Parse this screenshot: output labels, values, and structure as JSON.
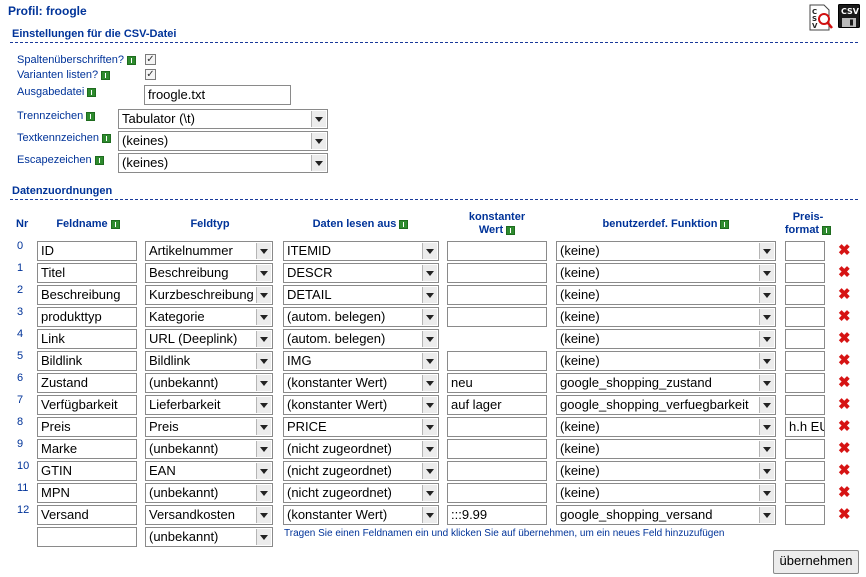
{
  "profile": {
    "title": "Profil: froogle"
  },
  "toolbar": {
    "csv_label": "CSV"
  },
  "csv_settings": {
    "heading": "Einstellungen für die CSV-Datei",
    "column_headers": {
      "label": "Spaltenüberschriften?",
      "checked": true
    },
    "list_variants": {
      "label": "Varianten listen?",
      "checked": true
    },
    "output_file": {
      "label": "Ausgabedatei",
      "value": "froogle.txt"
    },
    "separator": {
      "label": "Trennzeichen",
      "value": "Tabulator (\\t)"
    },
    "text_qualifier": {
      "label": "Textkennzeichen",
      "value": "(keines)"
    },
    "escape_char": {
      "label": "Escapezeichen",
      "value": "(keines)"
    }
  },
  "mapping": {
    "heading": "Datenzuordnungen",
    "columns": {
      "nr": "Nr",
      "field_name": "Feldname",
      "field_type": "Feldtyp",
      "read_from": "Daten lesen aus",
      "constant": [
        "konstanter",
        "Wert"
      ],
      "function": "benutzerdef. Funktion",
      "price_format": [
        "Preis-",
        "format"
      ]
    },
    "rows": [
      {
        "nr": "0",
        "name": "ID",
        "type": "Artikelnummer",
        "source": "ITEMID",
        "constant": "",
        "constant_field": true,
        "func": "(keine)",
        "price": ""
      },
      {
        "nr": "1",
        "name": "Titel",
        "type": "Beschreibung",
        "source": "DESCR",
        "constant": "",
        "constant_field": true,
        "func": "(keine)",
        "price": ""
      },
      {
        "nr": "2",
        "name": "Beschreibung",
        "type": "Kurzbeschreibung",
        "source": "DETAIL",
        "constant": "",
        "constant_field": true,
        "func": "(keine)",
        "price": ""
      },
      {
        "nr": "3",
        "name": "produkttyp",
        "type": "Kategorie",
        "source": "(autom. belegen)",
        "constant": "",
        "constant_field": true,
        "func": "(keine)",
        "price": ""
      },
      {
        "nr": "4",
        "name": "Link",
        "type": "URL (Deeplink)",
        "source": "(autom. belegen)",
        "constant": "",
        "constant_field": false,
        "func": "(keine)",
        "price": ""
      },
      {
        "nr": "5",
        "name": "Bildlink",
        "type": "Bildlink",
        "source": "IMG",
        "constant": "",
        "constant_field": true,
        "func": "(keine)",
        "price": ""
      },
      {
        "nr": "6",
        "name": "Zustand",
        "type": "(unbekannt)",
        "source": "(konstanter Wert)",
        "constant": "neu",
        "constant_field": true,
        "func": "google_shopping_zustand",
        "price": ""
      },
      {
        "nr": "7",
        "name": "Verfügbarkeit",
        "type": "Lieferbarkeit",
        "source": "(konstanter Wert)",
        "constant": "auf lager",
        "constant_field": true,
        "func": "google_shopping_verfuegbarkeit",
        "price": ""
      },
      {
        "nr": "8",
        "name": "Preis",
        "type": "Preis",
        "source": "PRICE",
        "constant": "",
        "constant_field": true,
        "func": "(keine)",
        "price": "h.h EUR"
      },
      {
        "nr": "9",
        "name": "Marke",
        "type": "(unbekannt)",
        "source": "(nicht zugeordnet)",
        "constant": "",
        "constant_field": true,
        "func": "(keine)",
        "price": ""
      },
      {
        "nr": "10",
        "name": "GTIN",
        "type": "EAN",
        "source": "(nicht zugeordnet)",
        "constant": "",
        "constant_field": true,
        "func": "(keine)",
        "price": ""
      },
      {
        "nr": "11",
        "name": "MPN",
        "type": "(unbekannt)",
        "source": "(nicht zugeordnet)",
        "constant": "",
        "constant_field": true,
        "func": "(keine)",
        "price": ""
      },
      {
        "nr": "12",
        "name": "Versand",
        "type": "Versandkosten",
        "source": "(konstanter Wert)",
        "constant": ":::9.99",
        "constant_field": true,
        "func": "google_shopping_versand",
        "price": ""
      }
    ],
    "new_row": {
      "name": "",
      "type": "(unbekannt)"
    },
    "hint": "Tragen Sie einen Feldnamen ein und klicken Sie auf übernehmen, um ein neues Feld hinzuzufügen",
    "apply_button": "übernehmen"
  }
}
